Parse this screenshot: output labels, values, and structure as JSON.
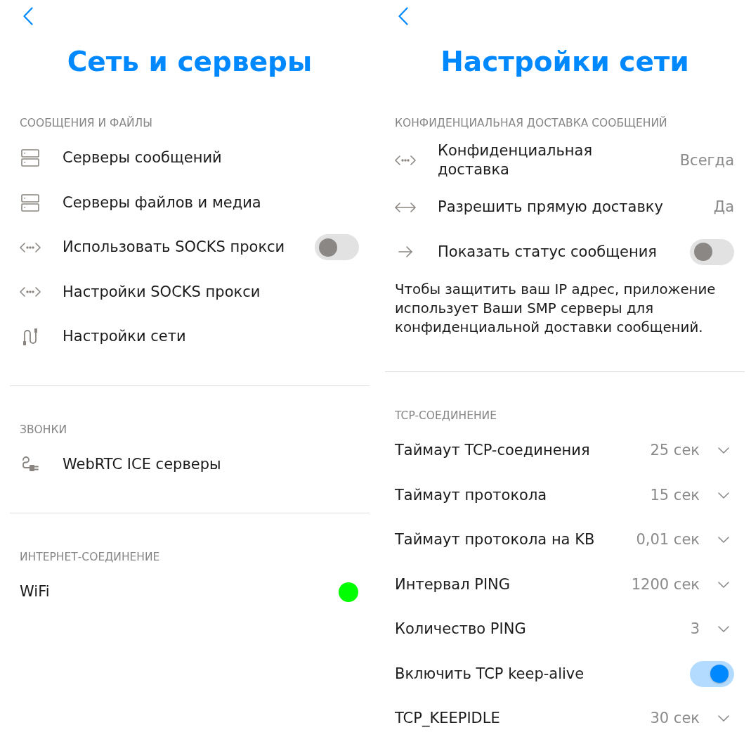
{
  "screens": [
    {
      "title": "Сеть и серверы",
      "sections": [
        {
          "header": "СООБЩЕНИЯ И ФАЙЛЫ",
          "items": [
            {
              "kind": "link",
              "label": "Серверы сообщений"
            },
            {
              "kind": "link",
              "label": "Серверы файлов и медиа"
            },
            {
              "kind": "toggle",
              "label": "Использовать SOCKS прокси",
              "on": false
            },
            {
              "kind": "link",
              "label": "Настройки SOCKS прокси"
            },
            {
              "kind": "link",
              "label": "Настройки сети"
            }
          ]
        },
        {
          "header": "ЗВОНКИ",
          "items": [
            {
              "kind": "link",
              "label": "WebRTC ICE серверы"
            }
          ]
        },
        {
          "header": "ИНТЕРНЕТ-СОЕДИНЕНИЕ",
          "items": [
            {
              "kind": "status",
              "label": "WiFi",
              "color": "#00ff00"
            }
          ]
        }
      ]
    },
    {
      "title": "Настройки сети",
      "sections": [
        {
          "header": "КОНФИДЕНЦИАЛЬНАЯ ДОСТАВКА СООБЩЕНИЙ",
          "items": [
            {
              "kind": "value",
              "label": "Конфиденциальная\nдоставка",
              "value": "Всегда"
            },
            {
              "kind": "value",
              "label": "Разрешить прямую доставку",
              "value": "Да"
            },
            {
              "kind": "toggle",
              "label": "Показать статус сообщения",
              "on": false
            }
          ],
          "note": "Чтобы защитить ваш IP адрес, приложение использует Ваши SMP серверы для конфиденциальной доставки сообщений."
        },
        {
          "header": "TCP-СОЕДИНЕНИЕ",
          "items": [
            {
              "kind": "select",
              "label": "Таймаут TCP-соединения",
              "value": "25 сек"
            },
            {
              "kind": "select",
              "label": "Таймаут протокола",
              "value": "15 сек"
            },
            {
              "kind": "select",
              "label": "Таймаут протокола на KB",
              "value": "0,01 сек"
            },
            {
              "kind": "select",
              "label": "Интервал PING",
              "value": "1200 сек"
            },
            {
              "kind": "select",
              "label": "Количество PING",
              "value": "3"
            },
            {
              "kind": "toggle",
              "label": "Включить TCP keep-alive",
              "on": true
            },
            {
              "kind": "select",
              "label": "TCP_KEEPIDLE",
              "value": "30 сек"
            }
          ]
        }
      ]
    }
  ]
}
